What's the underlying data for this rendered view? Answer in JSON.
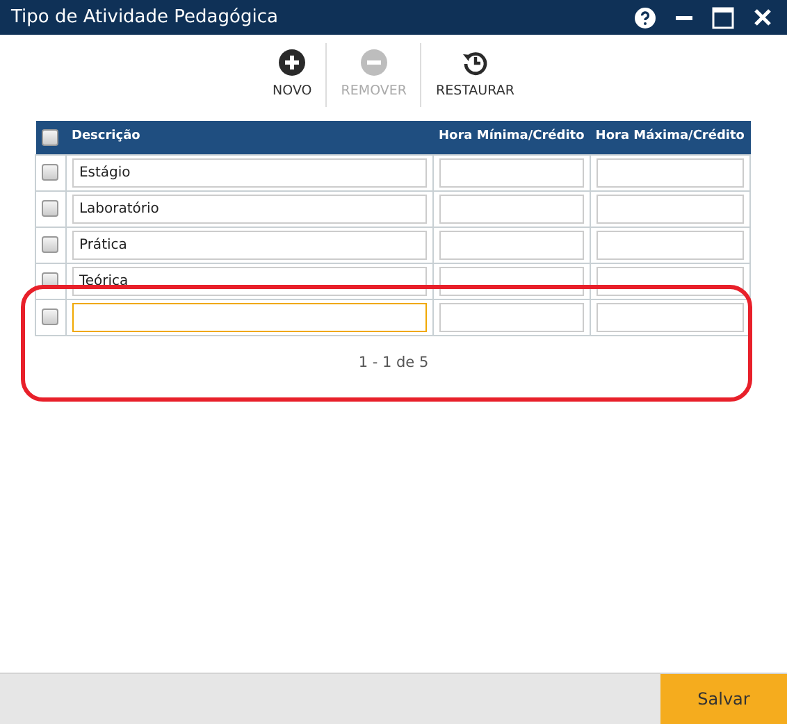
{
  "window": {
    "title": "Tipo de Atividade Pedagógica"
  },
  "toolbar": [
    {
      "kind": "add",
      "label": "NOVO",
      "disabled": false
    },
    {
      "kind": "remove",
      "label": "REMOVER",
      "disabled": true
    },
    {
      "kind": "restore",
      "label": "RESTAURAR",
      "disabled": false
    }
  ],
  "table": {
    "select_all_checked": false,
    "columns": [
      "Descrição",
      "Hora Mínima/Crédito",
      "Hora Máxima/Crédito"
    ],
    "rows": [
      {
        "checked": false,
        "descricao": "Estágio",
        "focused": false
      },
      {
        "checked": false,
        "descricao": "Laboratório",
        "focused": false
      },
      {
        "checked": false,
        "descricao": "Prática",
        "focused": false
      },
      {
        "checked": false,
        "descricao": "Teórica",
        "focused": false
      },
      {
        "checked": false,
        "focused": true
      }
    ]
  },
  "pagination": "1 - 1 de 5",
  "annotation_highlight": true,
  "footer": {
    "save_button": "Salvar"
  }
}
